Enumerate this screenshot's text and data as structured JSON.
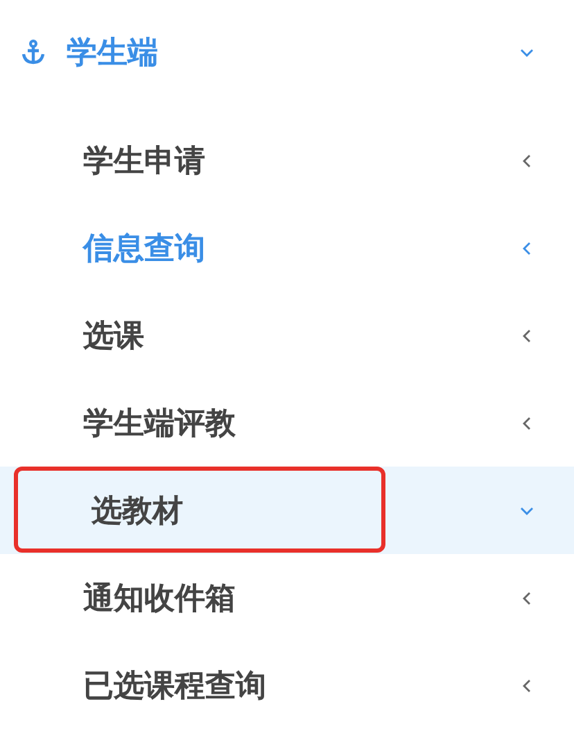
{
  "menu": {
    "title": "学生端",
    "expanded": true,
    "items": [
      {
        "label": "学生申请",
        "active": false,
        "expanded": false,
        "highlighted": false
      },
      {
        "label": "信息查询",
        "active": true,
        "expanded": false,
        "highlighted": false
      },
      {
        "label": "选课",
        "active": false,
        "expanded": false,
        "highlighted": false
      },
      {
        "label": "学生端评教",
        "active": false,
        "expanded": false,
        "highlighted": false
      },
      {
        "label": "选教材",
        "active": false,
        "expanded": true,
        "highlighted": true
      },
      {
        "label": "通知收件箱",
        "active": false,
        "expanded": false,
        "highlighted": false
      },
      {
        "label": "已选课程查询",
        "active": false,
        "expanded": false,
        "highlighted": false
      }
    ]
  }
}
